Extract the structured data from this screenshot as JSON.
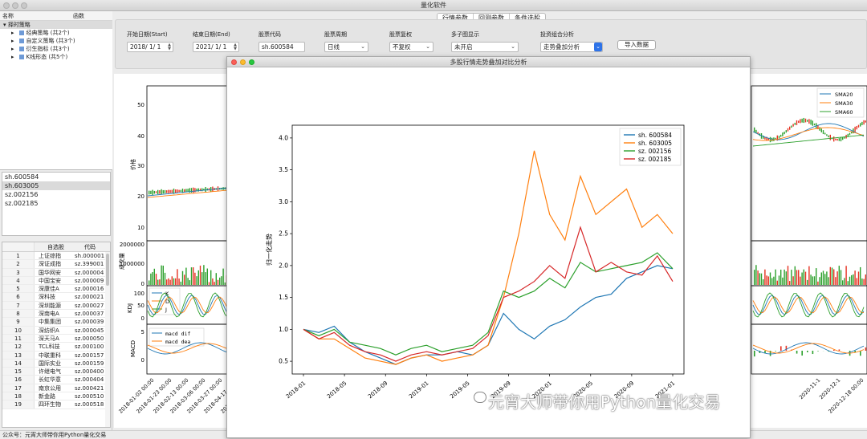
{
  "window": {
    "title": "量化软件"
  },
  "tree": {
    "col_name": "名称",
    "col_func": "函数",
    "root": "择时策略",
    "children": [
      "经典策略 (共2个)",
      "自定义策略 (共3个)",
      "衍生指标 (共3个)",
      "K线形态 (共5个)"
    ]
  },
  "stock_list": [
    "sh.600584",
    "sh.603005",
    "sz.002156",
    "sz.002185"
  ],
  "watch_table": {
    "headers": [
      "",
      "自选股",
      "代码"
    ],
    "rows": [
      [
        "1",
        "上证综指",
        "sh.000001"
      ],
      [
        "2",
        "深证成指",
        "sz.399001"
      ],
      [
        "3",
        "国华网安",
        "sz.000004"
      ],
      [
        "4",
        "中国宝安",
        "sz.000009"
      ],
      [
        "5",
        "深康佳A",
        "sz.000016"
      ],
      [
        "6",
        "深科技",
        "sz.000021"
      ],
      [
        "7",
        "深圳能源",
        "sz.000027"
      ],
      [
        "8",
        "深南电A",
        "sz.000037"
      ],
      [
        "9",
        "中集集团",
        "sz.000039"
      ],
      [
        "10",
        "深纺织A",
        "sz.000045"
      ],
      [
        "11",
        "深天马A",
        "sz.000050"
      ],
      [
        "12",
        "TCL科技",
        "sz.000100"
      ],
      [
        "13",
        "中联重科",
        "sz.000157"
      ],
      [
        "14",
        "国际实业",
        "sz.000159"
      ],
      [
        "15",
        "许继电气",
        "sz.000400"
      ],
      [
        "16",
        "长虹华意",
        "sz.000404"
      ],
      [
        "17",
        "南京公用",
        "sz.000421"
      ],
      [
        "18",
        "新金路",
        "sz.000510"
      ],
      [
        "19",
        "四环生物",
        "sz.000518"
      ]
    ]
  },
  "status_text": "公众号：元宵大师带你用Python量化交易",
  "tabs": [
    "行情参数",
    "回测参数",
    "条件选股"
  ],
  "toolbar": {
    "start_label": "开始日期(Start)",
    "start_value": "2018/ 1/ 1",
    "end_label": "结束日期(End)",
    "end_value": "2021/ 1/ 1",
    "code_label": "股票代码",
    "code_value": "sh.600584",
    "period_label": "股票周期",
    "period_value": "日线",
    "adjust_label": "股票复权",
    "adjust_value": "不复权",
    "subplot_label": "多子图显示",
    "subplot_value": "未开启",
    "combo_label": "投资组合分析",
    "combo_value": "走势叠加分析",
    "import_button": "导入数据"
  },
  "main_chart": {
    "price_label": "价格",
    "price_ticks": [
      "50",
      "40",
      "30",
      "20",
      "10"
    ],
    "vol_label": "成交量",
    "vol_ticks": [
      "2000000",
      "1000000",
      "0"
    ],
    "kdj_label": "KDJ",
    "kdj_ticks": [
      "100",
      "50",
      "0"
    ],
    "kdj_legend": [
      "K",
      "D",
      "J"
    ],
    "macd_label": "MACD",
    "macd_ticks": [
      "5",
      "0"
    ],
    "macd_legend": [
      "macd dif",
      "macd dea"
    ],
    "sma_legend": [
      "SMA20",
      "SMA30",
      "SMA60"
    ],
    "date_ticks_left": [
      "2018-01-02 00:00",
      "2018-01-23 00:00",
      "2018-02-13 00:00",
      "2018-03-06 00:00",
      "2018-03-27 00:00",
      "2018-04-17 00:00",
      "2018-05-08 00:00"
    ],
    "date_ticks_right": [
      "2020-11-1",
      "2020-12-1",
      "2020-12-18 00:00"
    ],
    "colors": {
      "up": "#e63222",
      "down": "#2ca02c",
      "sma20": "#1f77b4",
      "sma30": "#ff7f0e",
      "sma60": "#2ca02c"
    }
  },
  "popup": {
    "title": "多股行情走势叠加对比分析"
  },
  "chart_data": {
    "type": "line",
    "title": "",
    "xlabel": "",
    "ylabel": "归一化走势",
    "x_ticks": [
      "2018-01",
      "2018-05",
      "2018-09",
      "2019-01",
      "2019-05",
      "2019-09",
      "2020-01",
      "2020-05",
      "2020-09",
      "2021-01"
    ],
    "ylim": [
      0.3,
      4.2
    ],
    "y_ticks": [
      0.5,
      1.0,
      1.5,
      2.0,
      2.5,
      3.0,
      3.5,
      4.0
    ],
    "legend_position": "top-right",
    "x": [
      "2018-01",
      "2018-03",
      "2018-05",
      "2018-07",
      "2018-09",
      "2018-11",
      "2019-01",
      "2019-03",
      "2019-05",
      "2019-07",
      "2019-09",
      "2019-11",
      "2020-01",
      "2020-02",
      "2020-03",
      "2020-04",
      "2020-05",
      "2020-06",
      "2020-07",
      "2020-08",
      "2020-09",
      "2020-10",
      "2020-11",
      "2020-12",
      "2021-01"
    ],
    "series": [
      {
        "name": "sh. 600584",
        "color": "#1f77b4",
        "values": [
          1.0,
          0.95,
          1.05,
          0.8,
          0.65,
          0.55,
          0.45,
          0.55,
          0.6,
          0.6,
          0.65,
          0.6,
          0.75,
          1.25,
          1.0,
          0.85,
          1.05,
          1.15,
          1.35,
          1.5,
          1.55,
          1.8,
          1.9,
          2.0,
          1.95
        ]
      },
      {
        "name": "sh. 603005",
        "color": "#ff7f0e",
        "values": [
          1.0,
          0.85,
          0.85,
          0.7,
          0.55,
          0.5,
          0.45,
          0.55,
          0.6,
          0.5,
          0.55,
          0.6,
          0.75,
          1.5,
          2.5,
          3.8,
          2.8,
          2.4,
          3.4,
          2.8,
          3.0,
          3.2,
          2.6,
          2.8,
          2.5
        ]
      },
      {
        "name": "sz. 002156",
        "color": "#2ca02c",
        "values": [
          1.0,
          0.9,
          1.0,
          0.8,
          0.75,
          0.7,
          0.6,
          0.7,
          0.75,
          0.65,
          0.7,
          0.75,
          0.95,
          1.6,
          1.5,
          1.6,
          1.8,
          1.65,
          2.05,
          1.9,
          1.95,
          2.0,
          2.05,
          2.2,
          1.95
        ]
      },
      {
        "name": "sz. 002185",
        "color": "#d62728",
        "values": [
          1.0,
          0.85,
          0.95,
          0.75,
          0.65,
          0.6,
          0.5,
          0.6,
          0.65,
          0.6,
          0.65,
          0.7,
          0.9,
          1.5,
          1.6,
          1.75,
          2.0,
          1.8,
          2.6,
          1.9,
          2.05,
          1.9,
          1.85,
          2.15,
          1.75
        ]
      }
    ]
  },
  "watermark": "元宵大师带你用Python量化交易"
}
